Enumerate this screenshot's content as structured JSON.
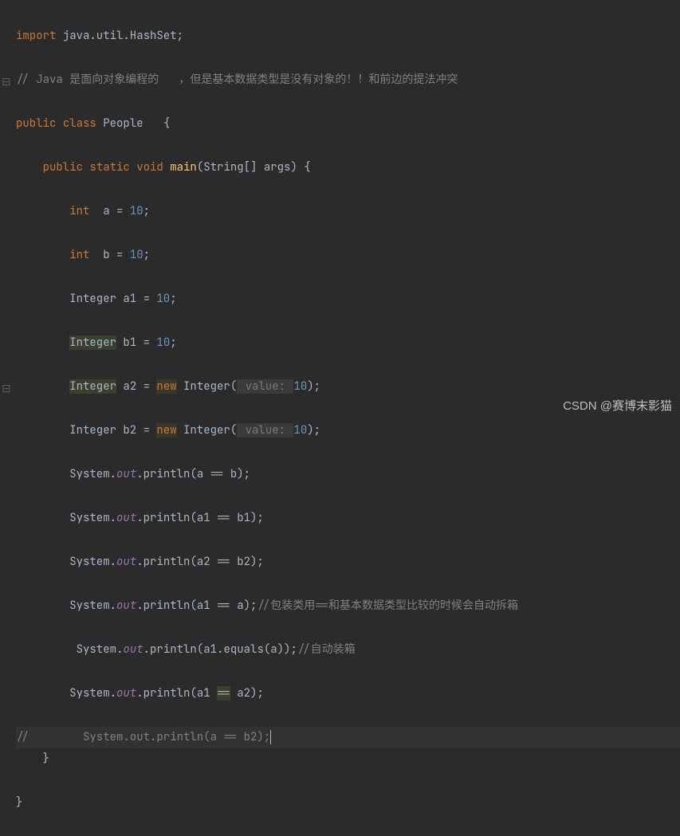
{
  "code": {
    "l1_import": "import",
    "l1_pkg": " java.util.HashSet;",
    "l2_comment": "// Java 是面向对象编程的   ，但是基本数据类型是没有对象的！！和前边的提法冲突",
    "l3_public": "public ",
    "l3_class": "class ",
    "l3_name": "People   ",
    "l3_brace": "{",
    "l4_public": "public ",
    "l4_static": "static ",
    "l4_void": "void ",
    "l4_main": "main",
    "l4_args": "(String[] args) {",
    "l5_int": "int ",
    "l5_a": " a = ",
    "l5_ten": "10",
    "l5_semi": ";",
    "l6_int": "int ",
    "l6_b": " b = ",
    "l6_ten": "10",
    "l6_semi": ";",
    "l7": "Integer a1 = ",
    "l7_ten": "10",
    "l7_semi": ";",
    "l8_type": "Integer",
    "l8_rest": " b1 = ",
    "l8_ten": "10",
    "l8_semi": ";",
    "l9_type": "Integer",
    "l9_rest": " a2 = ",
    "l9_new": "new",
    "l9_ctor": " Integer(",
    "l9_hint": " value: ",
    "l9_ten": "10",
    "l9_close": ");",
    "l10": "Integer b2 = ",
    "l10_new": "new",
    "l10_ctor": " Integer(",
    "l10_hint": " value: ",
    "l10_ten": "10",
    "l10_close": ");",
    "sys": "System.",
    "out": "out",
    "dot": ".",
    "println": "println",
    "l11_arg": "(a == b);",
    "l12_arg": "(a1 == b1);",
    "l13_arg": "(a2 == b2);",
    "l14_arg": "(a1 == a);",
    "l14_comment": "//包装类用==和基本数据类型比较的时候会自动拆箱",
    "l15_arg": "(a1.equals(a));",
    "l15_comment": "//自动装箱",
    "l16_arg_a": "(a1 ",
    "l16_eq": "==",
    "l16_arg_b": " a2);",
    "l17_comment": "//        System.out.println(a == b2);",
    "l18_brace": "}",
    "l19_brace": "}"
  },
  "gutter": {
    "collapse": "⊟",
    "end": "⊟"
  },
  "watermark": "CSDN @赛博末影猫"
}
